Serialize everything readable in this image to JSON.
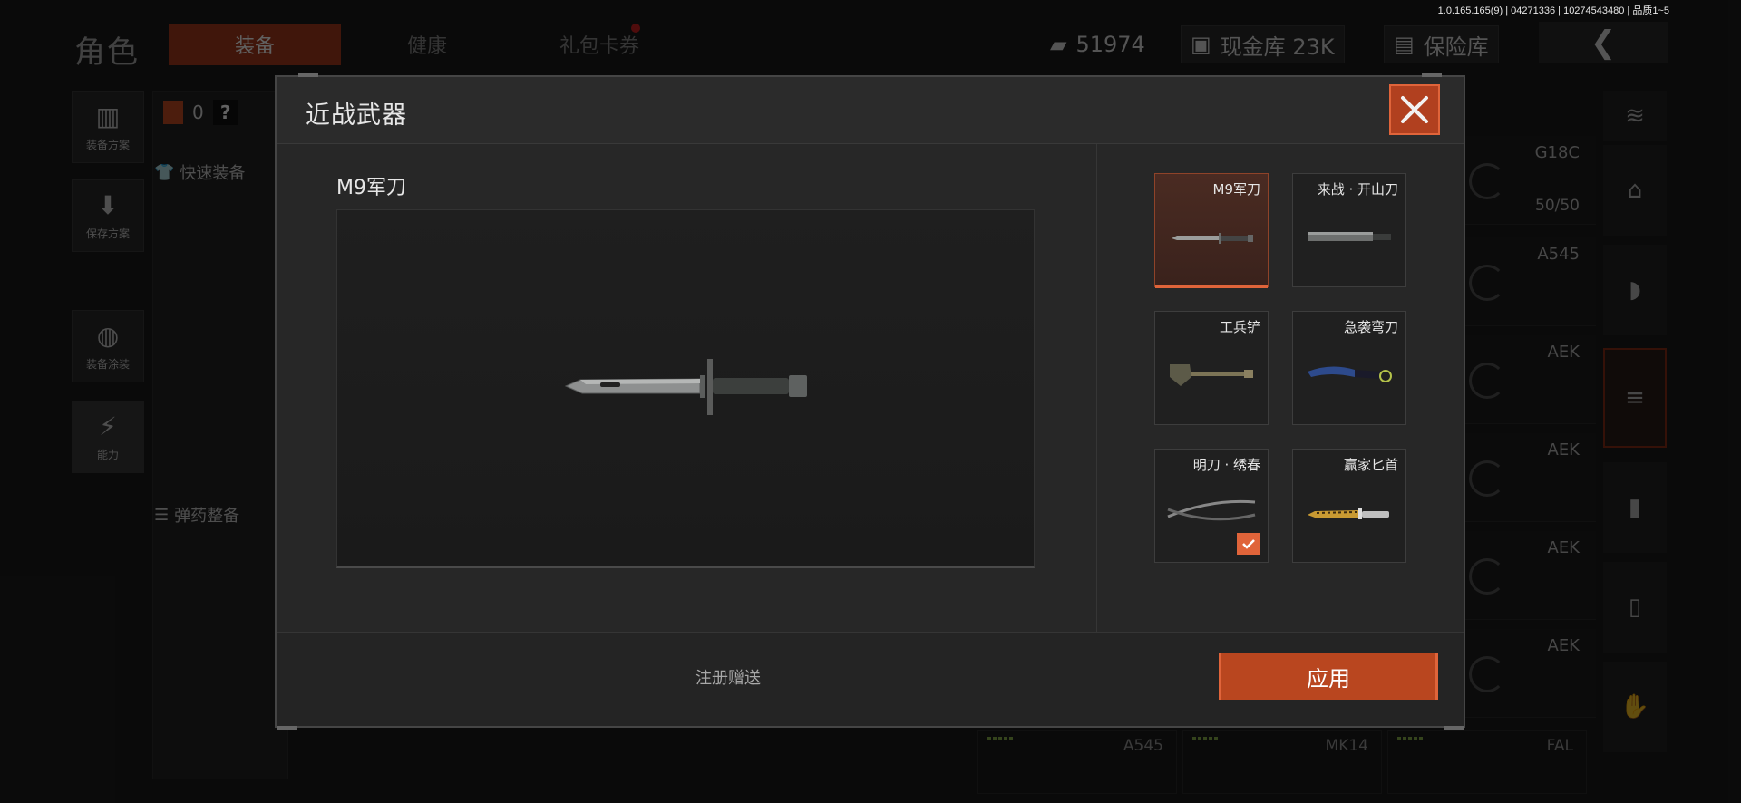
{
  "version": "1.0.165.165(9) | 04271336 | 10274543480 | 品质1~5",
  "background": {
    "title": "角色",
    "tabs": [
      "装备",
      "健康",
      "礼包卡券"
    ],
    "currency": "51974",
    "cash_vault": "现金库 23K",
    "safe_box": "保险库",
    "left_counter": "0",
    "side_buttons": [
      "装备方案",
      "保存方案",
      "装备涂装",
      "能力"
    ],
    "quick_equip": "快速装备",
    "ammo_tidy": "弹药整备",
    "slots": [
      {
        "name": "G18C",
        "count": "50/50"
      },
      {
        "name": "A545",
        "count": ""
      },
      {
        "name": "AEK",
        "count": ""
      },
      {
        "name": "AEK",
        "count": ""
      },
      {
        "name": "AEK",
        "count": ""
      },
      {
        "name": "AEK",
        "count": ""
      },
      {
        "name": "FAL",
        "count": ""
      }
    ],
    "bottom_cards": [
      "A545",
      "MK14",
      "FAL"
    ]
  },
  "modal": {
    "title": "近战武器",
    "selected_name": "M9军刀",
    "items": [
      {
        "name": "M9军刀",
        "selected": true,
        "equipped": false
      },
      {
        "name": "来战 · 开山刀",
        "selected": false,
        "equipped": false
      },
      {
        "name": "工兵铲",
        "selected": false,
        "equipped": false
      },
      {
        "name": "急袭弯刀",
        "selected": false,
        "equipped": false
      },
      {
        "name": "明刀 · 绣春",
        "selected": false,
        "equipped": true
      },
      {
        "name": "赢家匕首",
        "selected": false,
        "equipped": false
      }
    ],
    "footer_text": "注册赠送",
    "apply_label": "应用"
  },
  "colors": {
    "accent": "#e0643a",
    "accent_dark": "#b9461f",
    "panel": "#272727"
  },
  "icons": {
    "close": "close-icon",
    "check": "check-icon",
    "back": "back-arrow-icon"
  }
}
